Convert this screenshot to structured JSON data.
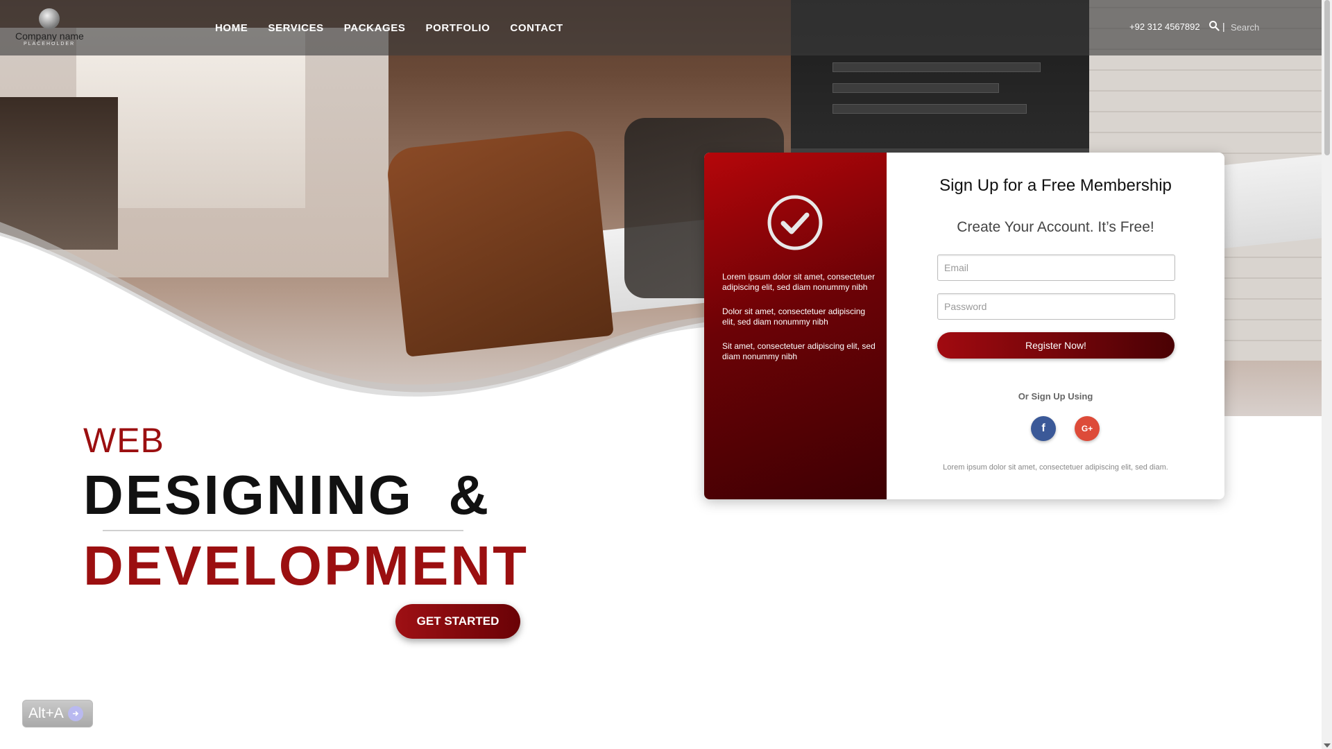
{
  "header": {
    "logo": {
      "name": "Company name",
      "tagline": "PLACEHOLDER"
    },
    "nav": [
      "HOME",
      "SERVICES",
      "PACKAGES",
      "PORTFOLIO",
      "CONTACT"
    ],
    "phone": "+92 312 4567892",
    "search_placeholder": "Search"
  },
  "hero": {
    "line1": "WEB",
    "line2": "DESIGNING  &",
    "line3": "DEVELOPMENT",
    "cta_label": "GET STARTED"
  },
  "signup": {
    "bullets": [
      "Lorem ipsum dolor sit amet, consectetuer adipiscing elit, sed diam nonummy nibh",
      "Dolor sit amet, consectetuer adipiscing elit, sed diam nonummy nibh",
      "Sit amet, consectetuer adipiscing elit, sed diam nonummy nibh"
    ],
    "title": "Sign Up for a Free Membership",
    "subtitle": "Create Your Account. It’s Free!",
    "email_placeholder": "Email",
    "password_placeholder": "Password",
    "register_label": "Register Now!",
    "or_text": "Or Sign Up Using",
    "facebook_label": "f",
    "google_label": "G+",
    "footer_text": "Lorem ipsum dolor sit amet, consectetuer adipiscing elit, sed diam."
  },
  "overlay": {
    "shortcut": "Alt+A"
  },
  "colors": {
    "accent": "#9b0f10",
    "dark_red": "#3e0003",
    "facebook": "#3b5998",
    "google": "#dd4b39"
  }
}
